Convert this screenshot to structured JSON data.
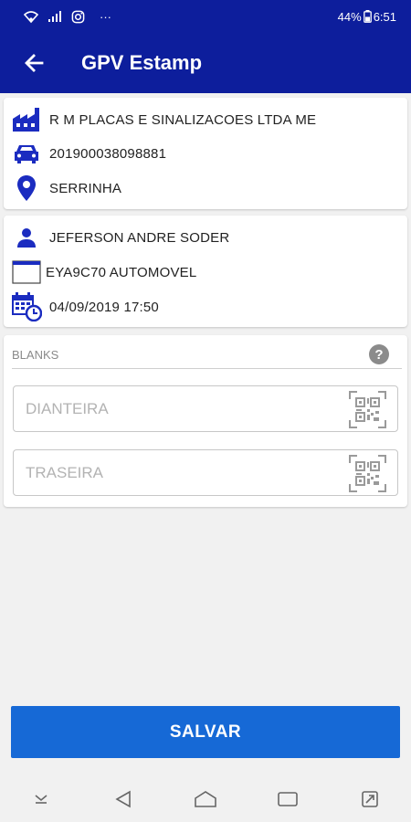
{
  "status_bar": {
    "battery": "44%",
    "time": "6:51",
    "dots": "···"
  },
  "app_bar": {
    "title": "GPV Estamp"
  },
  "company": {
    "name": "R M PLACAS E SINALIZACOES LTDA ME",
    "number": "201900038098881",
    "city": "SERRINHA"
  },
  "vehicle": {
    "owner": "JEFERSON ANDRE SODER",
    "plate": "EYA9C70 AUTOMOVEL",
    "datetime": "04/09/2019 17:50"
  },
  "blanks": {
    "label": "BLANKS",
    "help": "?",
    "front_placeholder": "DIANTEIRA",
    "rear_placeholder": "TRASEIRA"
  },
  "save_label": "SALVAR",
  "colors": {
    "primary": "#0d1e9c",
    "button": "#1669d6",
    "icon": "#1b2cc0"
  }
}
